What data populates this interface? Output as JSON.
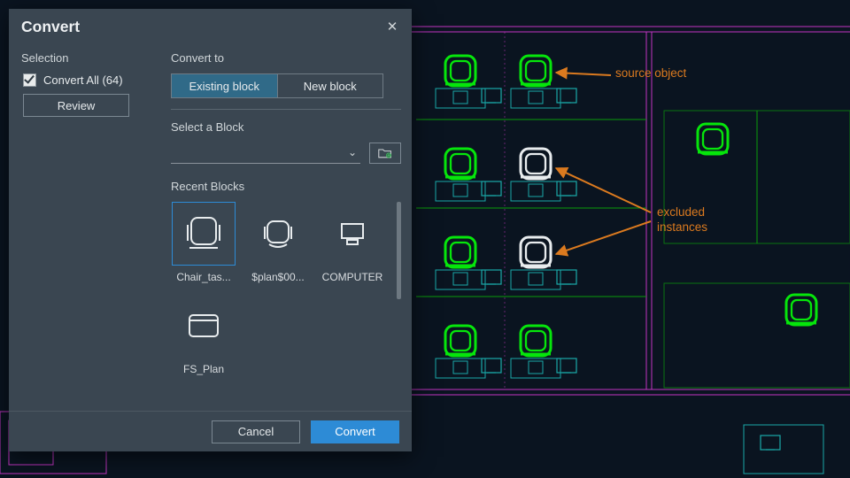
{
  "dialog": {
    "title": "Convert",
    "selection_label": "Selection",
    "convert_all_label": "Convert All (64)",
    "review_label": "Review",
    "convert_to_label": "Convert to",
    "toggle": {
      "existing": "Existing block",
      "newblock": "New block"
    },
    "select_block_label": "Select a Block",
    "recent_label": "Recent Blocks",
    "recent_blocks": [
      {
        "label": "Chair_tas...",
        "icon": "chair"
      },
      {
        "label": "$plan$00...",
        "icon": "chair2"
      },
      {
        "label": "COMPUTER",
        "icon": "computer"
      },
      {
        "label": "FS_Plan",
        "icon": "fs"
      }
    ],
    "footer": {
      "cancel": "Cancel",
      "convert": "Convert"
    }
  },
  "annotations": {
    "source": "source object",
    "excluded_line1": "excluded",
    "excluded_line2": "instances"
  },
  "colors": {
    "accent": "#2d8bd6",
    "highlight": "#06e60b",
    "callout": "#db7a1f",
    "magenta": "#c235c2",
    "cyan": "#1aa9a9"
  }
}
